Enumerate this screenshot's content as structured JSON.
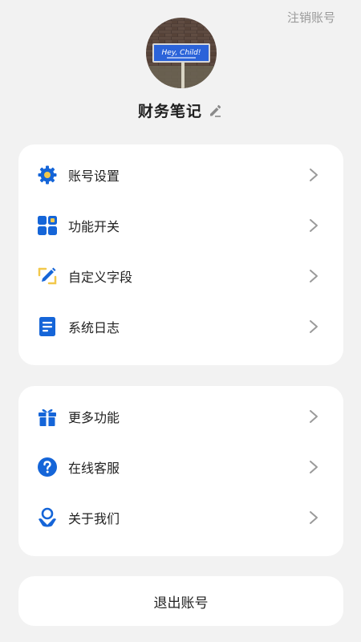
{
  "header": {
    "deregister_label": "注销账号"
  },
  "profile": {
    "avatar_sign_text": "Hey, Child!",
    "name": "财务笔记"
  },
  "menu_group_1": [
    {
      "label": "账号设置",
      "icon": "gear-icon"
    },
    {
      "label": "功能开关",
      "icon": "grid-icon"
    },
    {
      "label": "自定义字段",
      "icon": "pencil-icon"
    },
    {
      "label": "系统日志",
      "icon": "document-icon"
    }
  ],
  "menu_group_2": [
    {
      "label": "更多功能",
      "icon": "gift-icon"
    },
    {
      "label": "在线客服",
      "icon": "question-icon"
    },
    {
      "label": "关于我们",
      "icon": "people-icon"
    }
  ],
  "logout": {
    "label": "退出账号"
  },
  "colors": {
    "accent": "#1565d8",
    "accent_light": "#f2c84b",
    "background": "#f2f2f2"
  }
}
